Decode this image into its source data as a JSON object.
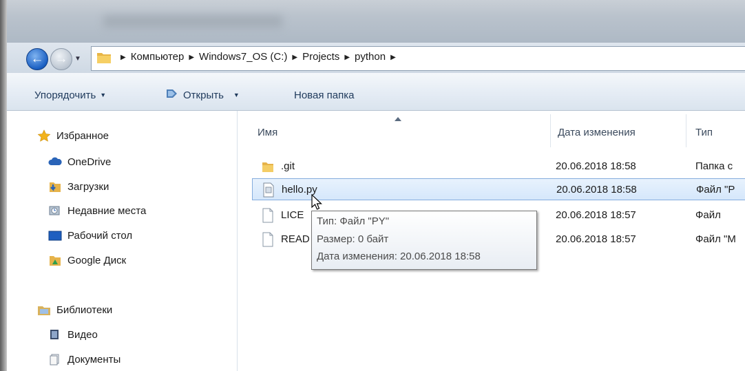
{
  "address": {
    "crumbs": [
      "Компьютер",
      "Windows7_OS (C:)",
      "Projects",
      "python"
    ]
  },
  "toolbar": {
    "organize_label": "Упорядочить",
    "open_label": "Открыть",
    "new_folder_label": "Новая папка"
  },
  "sidebar": {
    "favorites_label": "Избранное",
    "favorites": [
      "OneDrive",
      "Загрузки",
      "Недавние места",
      "Рабочий стол",
      "Google Диск"
    ],
    "libraries_label": "Библиотеки",
    "libraries": [
      "Видео",
      "Документы"
    ]
  },
  "columns": {
    "name": "Имя",
    "date": "Дата изменения",
    "type": "Тип"
  },
  "files": [
    {
      "name": ".git",
      "date": "20.06.2018 18:58",
      "type": "Папка с"
    },
    {
      "name": "hello.py",
      "date": "20.06.2018 18:58",
      "type": "Файл \"P"
    },
    {
      "name": "LICE",
      "date": "20.06.2018 18:57",
      "type": "Файл"
    },
    {
      "name": "READ",
      "date": "20.06.2018 18:57",
      "type": "Файл \"M"
    }
  ],
  "tooltip": {
    "type_line": "Тип: Файл \"PY\"",
    "size_line": "Размер: 0 байт",
    "date_line": "Дата изменения: 20.06.2018 18:58"
  },
  "colors": {
    "accent": "#1a5fc2",
    "selection": "#d5e7fb",
    "toolbar_text": "#1e395b"
  }
}
